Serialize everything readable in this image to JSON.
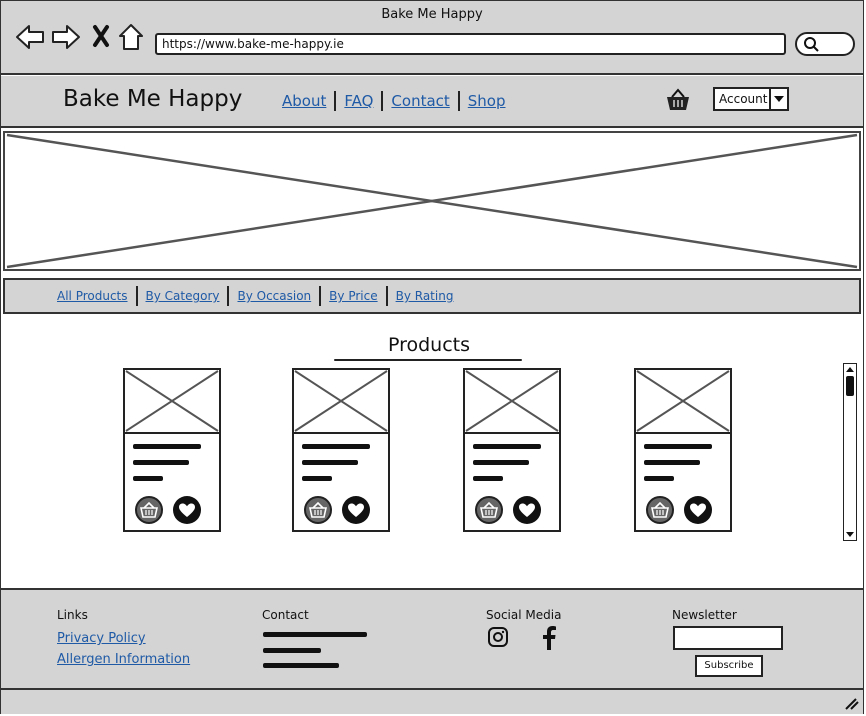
{
  "window": {
    "title": "Bake Me Happy"
  },
  "browser": {
    "url": "https://www.bake-me-happy.ie"
  },
  "header": {
    "brand": "Bake Me Happy",
    "nav": [
      "About",
      "FAQ",
      "Contact",
      "Shop"
    ],
    "account_label": "Account"
  },
  "filters": [
    "All Products",
    "By Category",
    "By Occasion",
    "By Price",
    "By Rating"
  ],
  "products": {
    "title": "Products",
    "card_count": 4
  },
  "footer": {
    "links_title": "Links",
    "links": [
      "Privacy Policy",
      "Allergen Information"
    ],
    "contact_title": "Contact",
    "social_title": "Social Media",
    "social_icons": [
      "instagram-icon",
      "facebook-icon"
    ],
    "newsletter_title": "Newsletter",
    "subscribe_label": "Subscribe"
  },
  "colors": {
    "chrome": "#d4d4d4",
    "link": "#1f5aa6",
    "ink": "#222222"
  }
}
